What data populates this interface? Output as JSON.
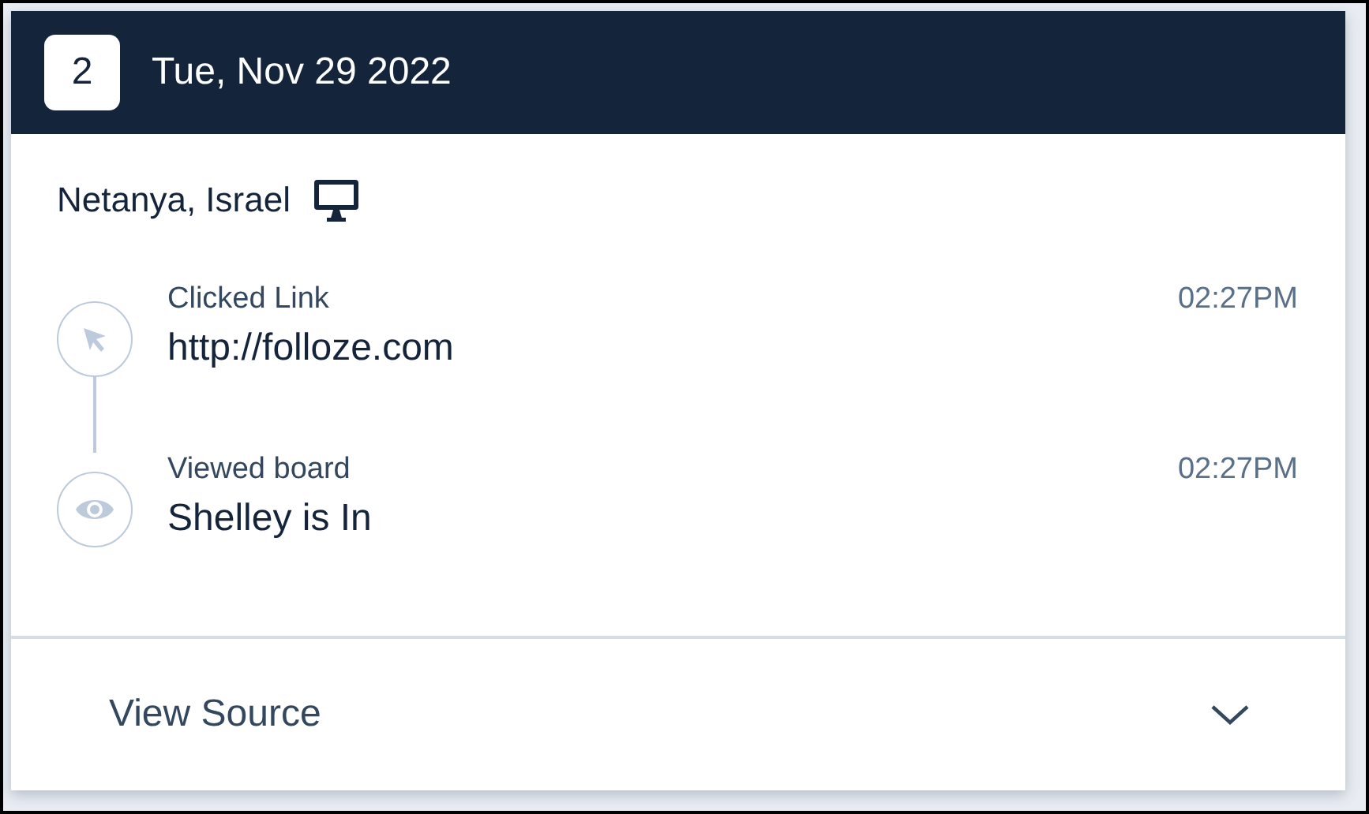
{
  "day": {
    "number": "2",
    "date": "Tue, Nov 29 2022"
  },
  "location": {
    "place": "Netanya, Israel",
    "kind": "desktop"
  },
  "events": [
    {
      "kind": "click",
      "action": "Clicked Link",
      "target": "http://folloze.com",
      "time": "02:27PM"
    },
    {
      "kind": "view",
      "action": "Viewed board",
      "target": "Shelley is In",
      "time": "02:27PM"
    }
  ],
  "source": {
    "label": "View Source",
    "expanded": false
  }
}
